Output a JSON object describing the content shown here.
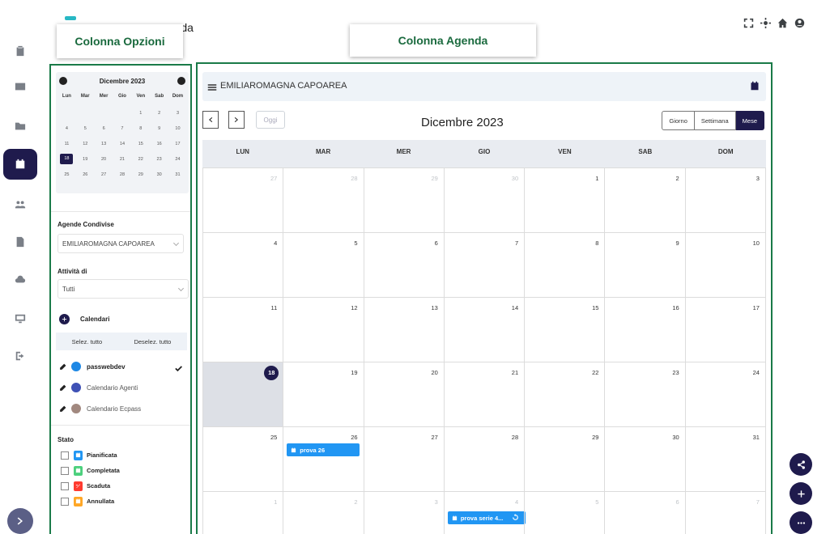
{
  "header": {
    "app_title": "genda"
  },
  "callouts": {
    "options": "Colonna Opzioni",
    "agenda": "Colonna Agenda"
  },
  "mini_calendar": {
    "title": "Dicembre 2023",
    "weekdays": [
      "Lun",
      "Mar",
      "Mer",
      "Gio",
      "Ven",
      "Sab",
      "Dom"
    ],
    "weeks": [
      [
        "",
        "",
        "",
        "",
        "1",
        "2",
        "3"
      ],
      [
        "4",
        "5",
        "6",
        "7",
        "8",
        "9",
        "10"
      ],
      [
        "11",
        "12",
        "13",
        "14",
        "15",
        "16",
        "17"
      ],
      [
        "18",
        "19",
        "20",
        "21",
        "22",
        "23",
        "24"
      ],
      [
        "25",
        "26",
        "27",
        "28",
        "29",
        "30",
        "31"
      ]
    ],
    "today": "18"
  },
  "options": {
    "shared_label": "Agende Condivise",
    "shared_value": "EMILIAROMAGNA CAPOAREA",
    "activity_label": "Attività di",
    "activity_value": "Tutti",
    "calendars_label": "Calendari",
    "select_all": "Selez. tutto",
    "deselect_all": "Deselez. tutto",
    "calendars": [
      {
        "name": "passwebdev",
        "color": "#1e88e5",
        "checked": true
      },
      {
        "name": "Calendario Agenti",
        "color": "#3f51b5",
        "checked": false
      },
      {
        "name": "Calendario Ecpass",
        "color": "#a1887f",
        "checked": false
      }
    ],
    "stato_label": "Stato",
    "states": [
      {
        "name": "Pianificata",
        "color": "#2196f3"
      },
      {
        "name": "Completata",
        "color": "#4cd07d"
      },
      {
        "name": "Scaduta",
        "color": "#ff3b30"
      },
      {
        "name": "Annullata",
        "color": "#ffa726"
      }
    ]
  },
  "agenda": {
    "name": "EMILIAROMAGNA CAPOAREA",
    "today_label": "Oggi",
    "month_title": "Dicembre 2023",
    "views": [
      "Giorno",
      "Settimana",
      "Mese"
    ],
    "active_view": "Mese",
    "weekdays": [
      "LUN",
      "MAR",
      "MER",
      "GIO",
      "VEN",
      "SAB",
      "DOM"
    ],
    "weeks": [
      [
        "27",
        "28",
        "29",
        "30",
        "1",
        "2",
        "3"
      ],
      [
        "4",
        "5",
        "6",
        "7",
        "8",
        "9",
        "10"
      ],
      [
        "11",
        "12",
        "13",
        "14",
        "15",
        "16",
        "17"
      ],
      [
        "18",
        "19",
        "20",
        "21",
        "22",
        "23",
        "24"
      ],
      [
        "25",
        "26",
        "27",
        "28",
        "29",
        "30",
        "31"
      ],
      [
        "1",
        "2",
        "3",
        "4",
        "5",
        "6",
        "7"
      ]
    ],
    "events": [
      {
        "title": "prova 26"
      },
      {
        "title": "prova serie 4..."
      }
    ]
  }
}
